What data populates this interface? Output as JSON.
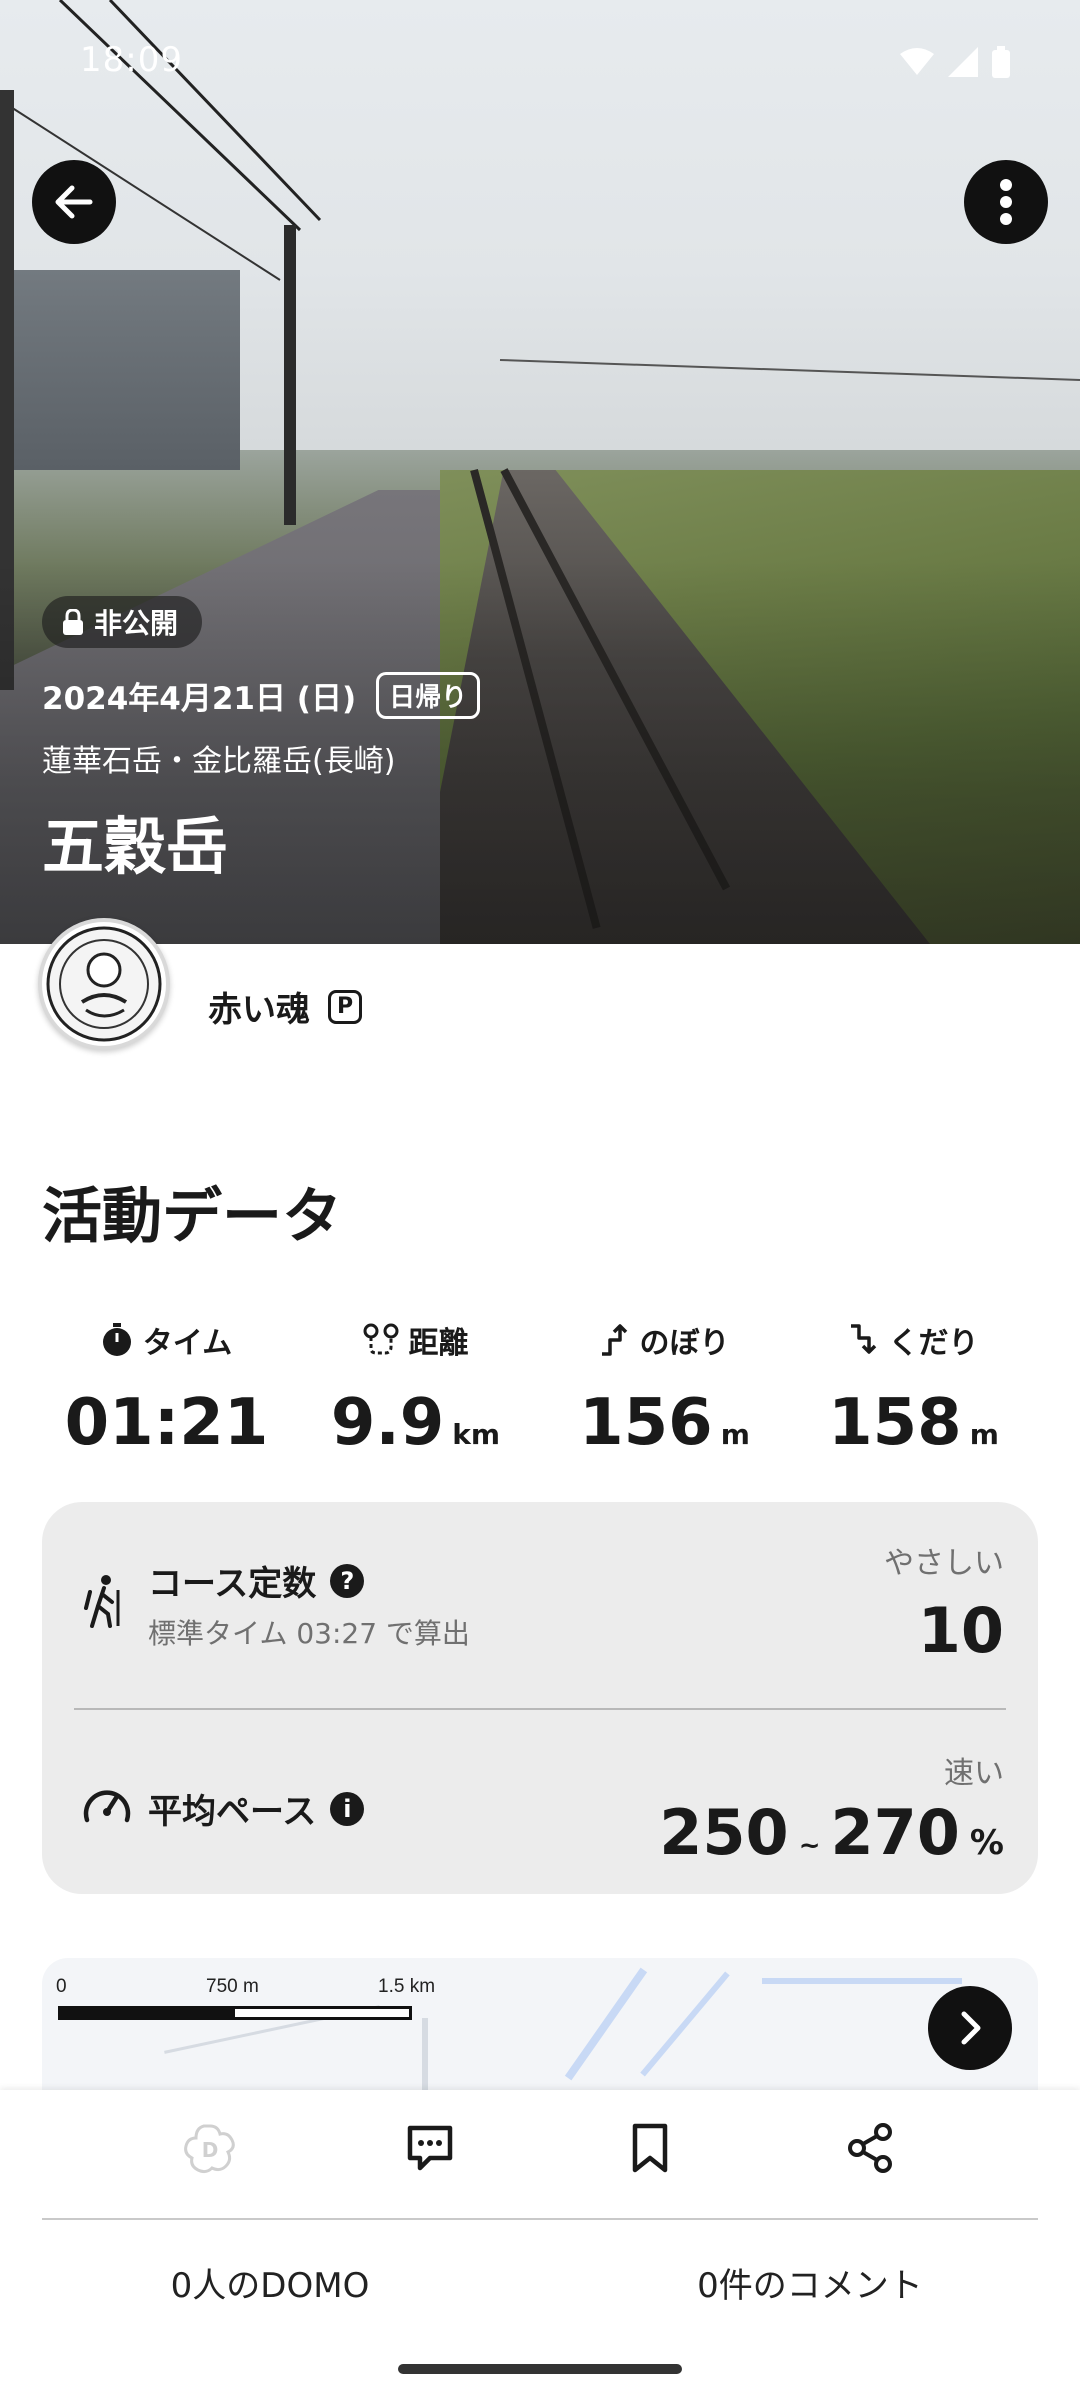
{
  "status_bar": {
    "time": "18:09"
  },
  "hero": {
    "visibility": "非公開",
    "date": "2024年4月21日 (日)",
    "trip_type": "日帰り",
    "area": "蓮華石岳・金比羅岳(長崎)",
    "mountain": "五穀岳"
  },
  "user": {
    "name": "赤い魂",
    "badge": "P"
  },
  "activity": {
    "title": "活動データ",
    "stats": [
      {
        "label": "タイム",
        "value": "01:21",
        "unit": "",
        "icon": "timer-icon"
      },
      {
        "label": "距離",
        "value": "9.9",
        "unit": "km",
        "icon": "route-icon"
      },
      {
        "label": "のぼり",
        "value": "156",
        "unit": "m",
        "icon": "ascent-icon"
      },
      {
        "label": "くだり",
        "value": "158",
        "unit": "m",
        "icon": "descent-icon"
      }
    ]
  },
  "course": {
    "title": "コース定数",
    "subtitle": "標準タイム 03:27 で算出",
    "level": "やさしい",
    "value": "10"
  },
  "pace": {
    "title": "平均ペース",
    "level": "速い",
    "from": "250",
    "sep": "~",
    "to": "270",
    "unit": "%"
  },
  "map": {
    "scale_labels": [
      "0",
      "750 m",
      "1.5 km"
    ]
  },
  "bottom": {
    "domo_count": "0人のDOMO",
    "comment_count": "0件のコメント"
  },
  "colors": {
    "accent": "#111111",
    "card_bg": "#ececec",
    "muted": "#707070"
  }
}
